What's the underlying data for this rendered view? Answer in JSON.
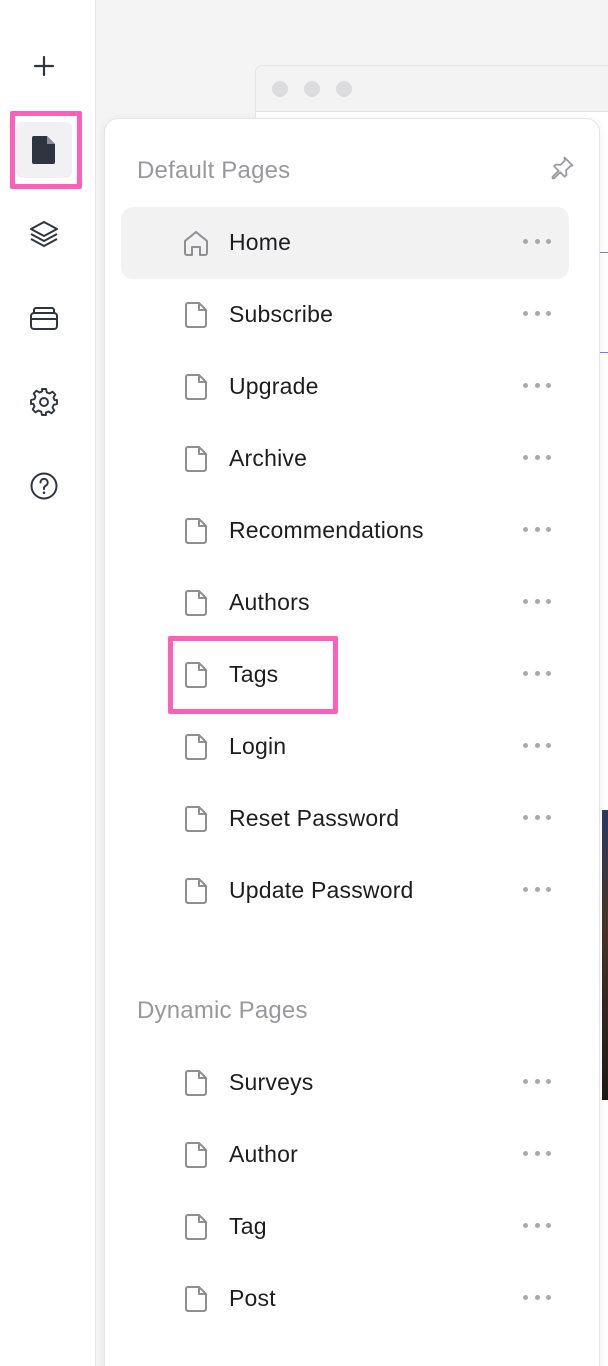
{
  "rail": {
    "items": [
      {
        "name": "add-button",
        "icon": "plus-icon"
      },
      {
        "name": "pages-button",
        "icon": "page-icon",
        "active": true
      },
      {
        "name": "layers-button",
        "icon": "layers-icon"
      },
      {
        "name": "components-button",
        "icon": "stack-icon"
      },
      {
        "name": "settings-button",
        "icon": "gear-icon"
      },
      {
        "name": "help-button",
        "icon": "help-icon"
      }
    ]
  },
  "panel": {
    "default_title": "Default Pages",
    "dynamic_title": "Dynamic Pages",
    "default_pages": [
      {
        "label": "Home",
        "icon": "home-icon",
        "selected": true
      },
      {
        "label": "Subscribe",
        "icon": "page-icon"
      },
      {
        "label": "Upgrade",
        "icon": "page-icon"
      },
      {
        "label": "Archive",
        "icon": "page-icon"
      },
      {
        "label": "Recommendations",
        "icon": "page-icon"
      },
      {
        "label": "Authors",
        "icon": "page-icon"
      },
      {
        "label": "Tags",
        "icon": "page-icon",
        "highlighted": true
      },
      {
        "label": "Login",
        "icon": "page-icon"
      },
      {
        "label": "Reset Password",
        "icon": "page-icon"
      },
      {
        "label": "Update Password",
        "icon": "page-icon"
      }
    ],
    "dynamic_pages": [
      {
        "label": "Surveys",
        "icon": "page-icon"
      },
      {
        "label": "Author",
        "icon": "page-icon"
      },
      {
        "label": "Tag",
        "icon": "page-icon"
      },
      {
        "label": "Post",
        "icon": "page-icon"
      }
    ]
  },
  "colors": {
    "highlight": "#ff5fb9",
    "selected_row": "#f2f2f3",
    "section_title": "#98989d",
    "icon_gray": "#8e8e93",
    "rail_icon": "#2f3540"
  }
}
